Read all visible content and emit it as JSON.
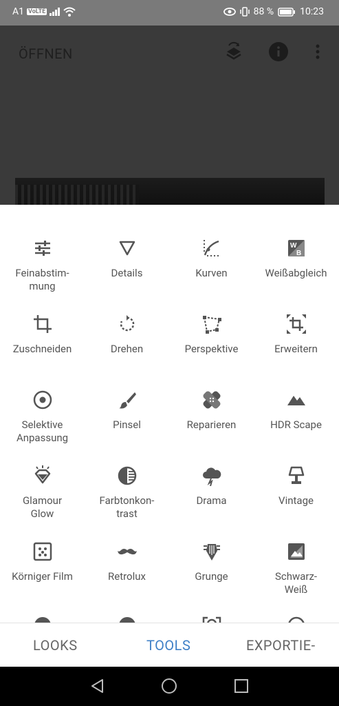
{
  "status": {
    "carrier": "A1",
    "volte": "VoLTE",
    "battery": "88 %",
    "time": "10:23"
  },
  "topbar": {
    "title": "ÖFFNEN"
  },
  "tools": [
    {
      "label": "Feinabstim-\nmung",
      "icon": "sliders-icon"
    },
    {
      "label": "Details",
      "icon": "triangle-icon"
    },
    {
      "label": "Kurven",
      "icon": "curve-icon"
    },
    {
      "label": "Weißabgleich",
      "icon": "wb-icon"
    },
    {
      "label": "Zuschneiden",
      "icon": "crop-icon"
    },
    {
      "label": "Drehen",
      "icon": "rotate-icon"
    },
    {
      "label": "Perspektive",
      "icon": "perspective-icon"
    },
    {
      "label": "Erweitern",
      "icon": "expand-icon"
    },
    {
      "label": "Selektive\nAnpassung",
      "icon": "target-icon"
    },
    {
      "label": "Pinsel",
      "icon": "brush-icon"
    },
    {
      "label": "Reparieren",
      "icon": "bandage-icon"
    },
    {
      "label": "HDR Scape",
      "icon": "mountain-icon"
    },
    {
      "label": "Glamour\nGlow",
      "icon": "diamond-icon"
    },
    {
      "label": "Farbtonkon-\ntrast",
      "icon": "tonal-icon"
    },
    {
      "label": "Drama",
      "icon": "cloud-icon"
    },
    {
      "label": "Vintage",
      "icon": "lamp-icon"
    },
    {
      "label": "Körniger Film",
      "icon": "grain-icon"
    },
    {
      "label": "Retrolux",
      "icon": "mustache-icon"
    },
    {
      "label": "Grunge",
      "icon": "guitar-icon"
    },
    {
      "label": "Schwarz-\nWeiß",
      "icon": "bw-icon"
    }
  ],
  "bottomnav": {
    "looks": "LOOKS",
    "tools": "TOOLS",
    "export": "EXPORTIE-"
  },
  "colors": {
    "accent": "#3f80c7",
    "icon": "#555555",
    "overlay": "#3a3a3a"
  }
}
